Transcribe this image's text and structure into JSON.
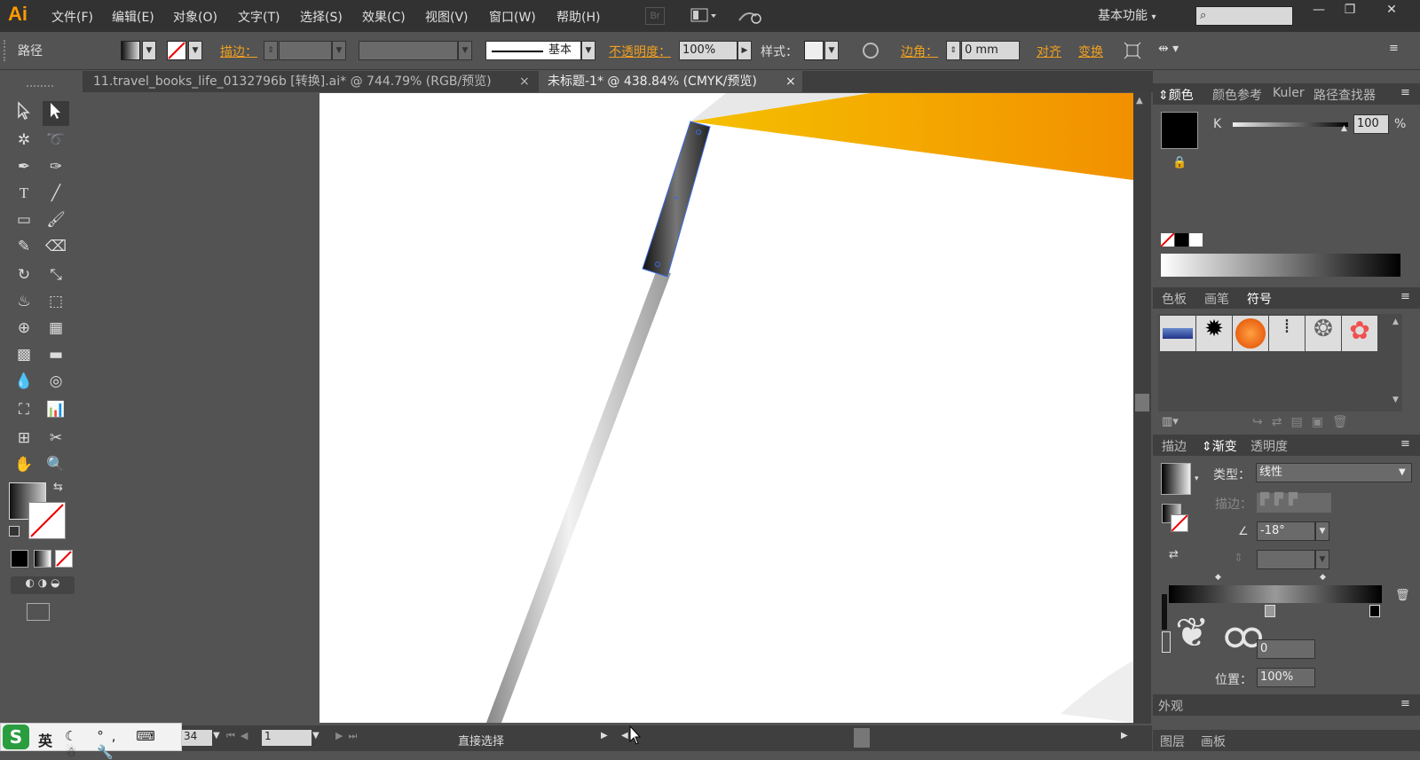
{
  "app": {
    "logo": "Ai",
    "workspace": "基本功能",
    "search_placeholder": ""
  },
  "menu": [
    "文件(F)",
    "编辑(E)",
    "对象(O)",
    "文字(T)",
    "选择(S)",
    "效果(C)",
    "视图(V)",
    "窗口(W)",
    "帮助(H)"
  ],
  "bridge_label": "Br",
  "control_bar": {
    "selection_type": "路径",
    "stroke_label": "描边：",
    "brush_label": "基本",
    "opacity_label": "不透明度：",
    "opacity_value": "100%",
    "style_label": "样式：",
    "corner_label": "边角：",
    "corner_value": "0 mm",
    "align_label": "对齐",
    "transform_label": "变换"
  },
  "tabs": [
    {
      "label": "11.travel_books_life_0132796b  [转换].ai* @ 744.79% (RGB/预览)",
      "close": "×"
    },
    {
      "label": "未标题-1* @ 438.84% (CMYK/预览)",
      "close": "×"
    }
  ],
  "color_panel": {
    "tabs": [
      "颜色",
      "颜色参考",
      "Kuler",
      "路径查找器"
    ],
    "channel": "K",
    "value": "100",
    "unit": "%"
  },
  "swatch_panel": {
    "tabs": [
      "色板",
      "画笔",
      "符号"
    ],
    "symbols": [
      "blue-banner-symbol",
      "ink-splat-symbol",
      "orange-sphere-symbol",
      "dotted-frame-symbol",
      "ring-symbol",
      "daisy-symbol"
    ]
  },
  "gradient_panel": {
    "tabs": [
      "描边",
      "渐变",
      "透明度"
    ],
    "type_label": "类型：",
    "type_value": "线性",
    "stroke_label": "描边：",
    "angle_value": "-18°",
    "opacity_label": "",
    "opacity_value": "0",
    "location_label": "位置：",
    "location_value": "100%"
  },
  "bottom_panels": {
    "appearance": "外观",
    "layers": "图层",
    "artboards": "画板"
  },
  "status": {
    "zoom": "34",
    "page": "1",
    "tool": "直接选择"
  },
  "ime": {
    "label": "英"
  },
  "colors": {
    "accent": "#f0a020",
    "orange_start": "#f5c000",
    "orange_end": "#f29000",
    "dark_bg": "#323232",
    "panel_bg": "#535353"
  }
}
